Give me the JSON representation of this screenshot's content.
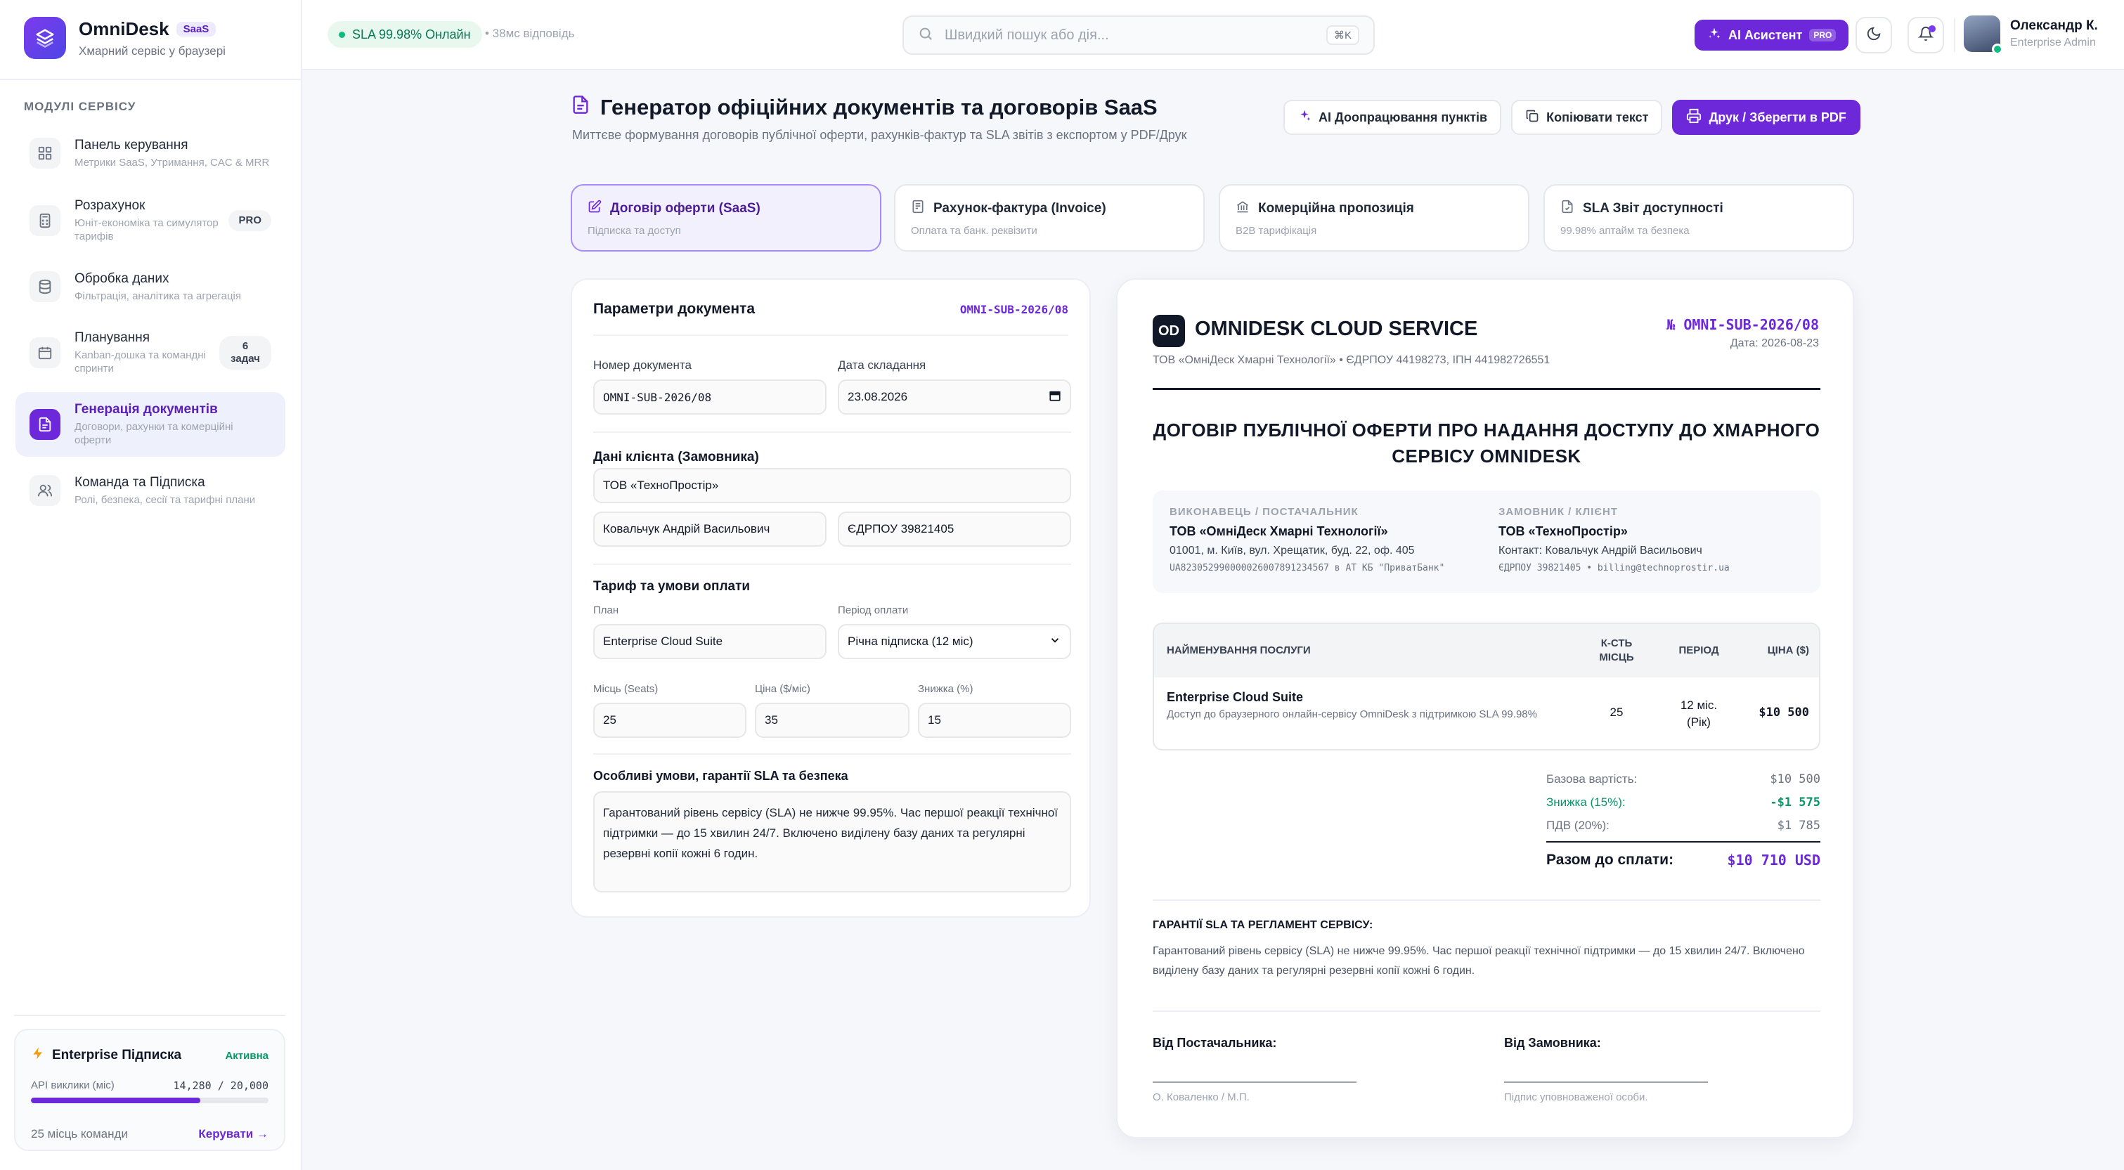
{
  "app": {
    "name": "OmniDesk",
    "badge": "SaaS",
    "tagline": "Хмарний сервіс у браузері"
  },
  "sidebar": {
    "section_title": "МОДУЛІ СЕРВІСУ",
    "items": [
      {
        "label": "Панель керування",
        "desc": "Метрики SaaS, Утримання, CAC & MRR",
        "tag": "",
        "icon": "dashboard-grid-icon"
      },
      {
        "label": "Розрахунок",
        "desc": "Юніт-економіка та симулятор тарифів",
        "tag": "PRO",
        "icon": "calculator-icon"
      },
      {
        "label": "Обробка даних",
        "desc": "Фільтрація, аналітика та агрегація",
        "tag": "",
        "icon": "database-icon"
      },
      {
        "label": "Планування",
        "desc": "Kanban-дошка та командні спринти",
        "tag": "6 задач",
        "icon": "calendar-icon"
      },
      {
        "label": "Генерація документів",
        "desc": "Договори, рахунки та комерційні оферти",
        "tag": "",
        "icon": "document-icon"
      },
      {
        "label": "Команда та Підписка",
        "desc": "Ролі, безпека, сесії та тарифні плани",
        "tag": "",
        "icon": "users-icon"
      }
    ],
    "subscription": {
      "title": "Enterprise Підписка",
      "status": "Активна",
      "api_label": "API виклики (міс)",
      "api_value": "14,280 / 20,000",
      "api_fraction": 0.714,
      "seats": "25 місць команди",
      "manage": "Керувати →"
    }
  },
  "topbar": {
    "sla": "SLA 99.98% Онлайн",
    "latency": "• 38мс відповідь",
    "search_placeholder": "Швидкий пошук або дія...",
    "search_shortcut": "⌘K",
    "ai_button": "AI Асистент",
    "ai_badge": "PRO",
    "user_name": "Олександр К.",
    "user_role": "Enterprise Admin"
  },
  "page": {
    "title": "Генератор офіційних документів та договорів SaaS",
    "subtitle": "Миттєве формування договорів публічної оферти, рахунків-фактур та SLA звітів з експортом у PDF/Друк",
    "actions": {
      "ai_refine": "AI Доопрацювання пунктів",
      "copy": "Копіювати текст",
      "print": "Друк / Зберегти в PDF"
    }
  },
  "tabs": [
    {
      "title": "Договір оферти (SaaS)",
      "sub": "Підписка та доступ",
      "icon": "edit-document-icon"
    },
    {
      "title": "Рахунок-фактура (Invoice)",
      "sub": "Оплата та банк. реквізити",
      "icon": "receipt-icon"
    },
    {
      "title": "Комерційна пропозиція",
      "sub": "B2B тарифікація",
      "icon": "bank-icon"
    },
    {
      "title": "SLA Звіт доступності",
      "sub": "99.98% аптайм та безпека",
      "icon": "file-check-icon"
    }
  ],
  "form": {
    "title": "Параметри документа",
    "code": "OMNI-SUB-2026/08",
    "doc_number_label": "Номер документа",
    "doc_number": "OMNI-SUB-2026/08",
    "date_label": "Дата складання",
    "date": "23.08.2026",
    "client_section": "Дані клієнта (Замовника)",
    "client_company": "ТОВ «ТехноПростір»",
    "client_contact": "Ковальчук Андрій Васильович",
    "client_edrpou": "ЄДРПОУ 39821405",
    "tariff_section": "Тариф та умови оплати",
    "plan_label": "План",
    "plan": "Enterprise Cloud Suite",
    "period_label": "Період оплати",
    "period": "Річна підписка (12 міс)",
    "seats_label": "Місць (Seats)",
    "seats": "25",
    "price_label": "Ціна ($/міс)",
    "price": "35",
    "discount_label": "Знижка (%)",
    "discount": "15",
    "terms_section": "Особливі умови, гарантії SLA та безпека",
    "terms": "Гарантований рівень сервісу (SLA) не нижче 99.95%. Час першої реакції технічної підтримки — до 15 хвилин 24/7. Включено виділену базу даних та регулярні резервні копії кожні 6 годин."
  },
  "preview": {
    "logo": "OD",
    "company": "OMNIDESK CLOUD SERVICE",
    "legal": "ТОВ «ОмніДеск Хмарні Технології» • ЄДРПОУ 44198273, ІПН 441982726551",
    "number": "№ OMNI-SUB-2026/08",
    "date": "Дата: 2026-08-23",
    "doc_title": "ДОГОВІР ПУБЛІЧНОЇ ОФЕРТИ ПРО НАДАННЯ ДОСТУПУ ДО ХМАРНОГО СЕРВІСУ OMNIDESK",
    "executor": {
      "caption": "ВИКОНАВЕЦЬ / ПОСТАЧАЛЬНИК",
      "name": "ТОВ «ОмніДеск Хмарні Технології»",
      "address": "01001, м. Київ, вул. Хрещатик, буд. 22, оф. 405",
      "bank": "UA823052990000026007891234567 в АТ КБ \"ПриватБанк\""
    },
    "customer": {
      "caption": "ЗАМОВНИК / КЛІЄНТ",
      "name": "ТОВ «ТехноПростір»",
      "contact": "Контакт: Ковальчук Андрій Васильович",
      "ids": "ЄДРПОУ 39821405 • billing@technoprostir.ua"
    },
    "table": {
      "h_service": "НАЙМЕНУВАННЯ ПОСЛУГИ",
      "h_seats": "К-СТЬ МІСЦЬ",
      "h_period": "ПЕРІОД",
      "h_price": "ЦІНА ($)",
      "service_name": "Enterprise Cloud Suite",
      "service_desc": "Доступ до браузерного онлайн-сервісу OmniDesk з підтримкою SLA 99.98%",
      "seats": "25",
      "period": "12 міс. (Рік)",
      "price": "$10 500"
    },
    "totals": {
      "base_label": "Базова вартість:",
      "base": "$10 500",
      "discount_label": "Знижка (15%):",
      "discount": "-$1 575",
      "vat_label": "ПДВ (20%):",
      "vat": "$1 785",
      "total_label": "Разом до сплати:",
      "total": "$10 710 USD"
    },
    "sla_caption": "ГАРАНТІЇ SLA ТА РЕГЛАМЕНТ СЕРВІСУ:",
    "sla_text": "Гарантований рівень сервісу (SLA) не нижче 99.95%. Час першої реакції технічної підтримки — до 15 хвилин 24/7. Включено виділену базу даних та регулярні резервні копії кожні 6 годин.",
    "sig_supplier": "Від Постачальника:",
    "sig_supplier_cap": "О. Коваленко / М.П.",
    "sig_customer": "Від Замовника:",
    "sig_customer_cap": "Підпис уповноваженої особи."
  },
  "colors": {
    "accent": "#6d28d9",
    "success": "#059669",
    "text": "#111827"
  }
}
